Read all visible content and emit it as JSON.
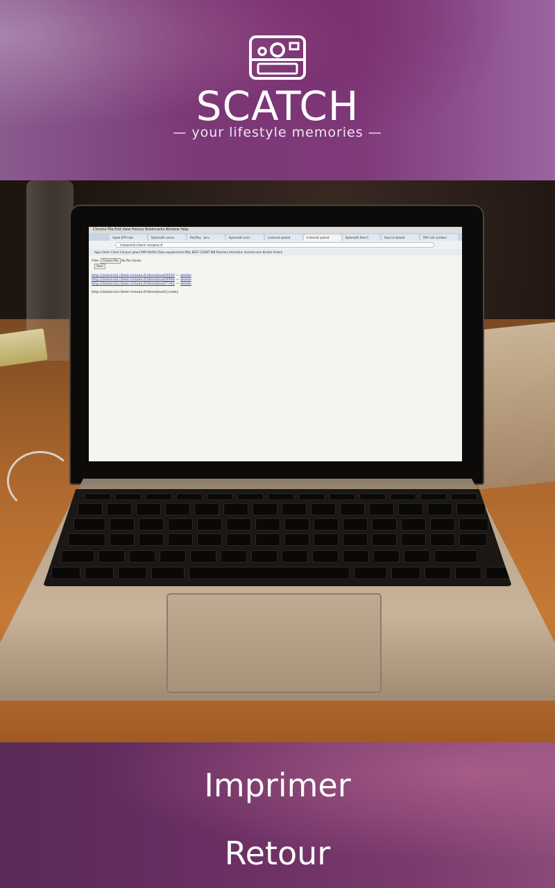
{
  "header": {
    "logo_icon": "camera-icon",
    "brand": "SCATCH",
    "tagline": "— your lifestyle memories —"
  },
  "photo": {
    "screen": {
      "menubar": "  Chrome   File   Edit   View   History   Bookmarks   Window   Help",
      "tabs": [
        "Apple EPP Inde",
        "Bytemath conne",
        "RestPay : Jecu",
        "Bytemath.xn/ci",
        "instaroid upload",
        "Instaroid upload",
        "Bytemath Rest C",
        "How to Upload",
        "PHP unit symbon"
      ],
      "url": "instaroid.client.viviane.fr",
      "bookmarks": "Apps   Safari   Client Campus   gmail   RMX   Netflix   Diplo   equipements   MDy   BEST CLIENT   WB   Teachers   Education   Scan4access   Kinetix   Prodck",
      "file_label": "File:",
      "choose_file": "Choose File",
      "no_file": "No file chosen",
      "save_label": "Save",
      "links": [
        "http://instaroid.client.viviane.fr/download/9659",
        "http://instaroid.client.viviane.fr/download/9948",
        "http://instaroid.client.viviane.fr/download/7162"
      ],
      "delete_label": "delete",
      "pattern_text": "http://instaroid.client.viviane.fr/download/{code}"
    }
  },
  "footer": {
    "print_label": "Imprimer",
    "back_label": "Retour"
  }
}
